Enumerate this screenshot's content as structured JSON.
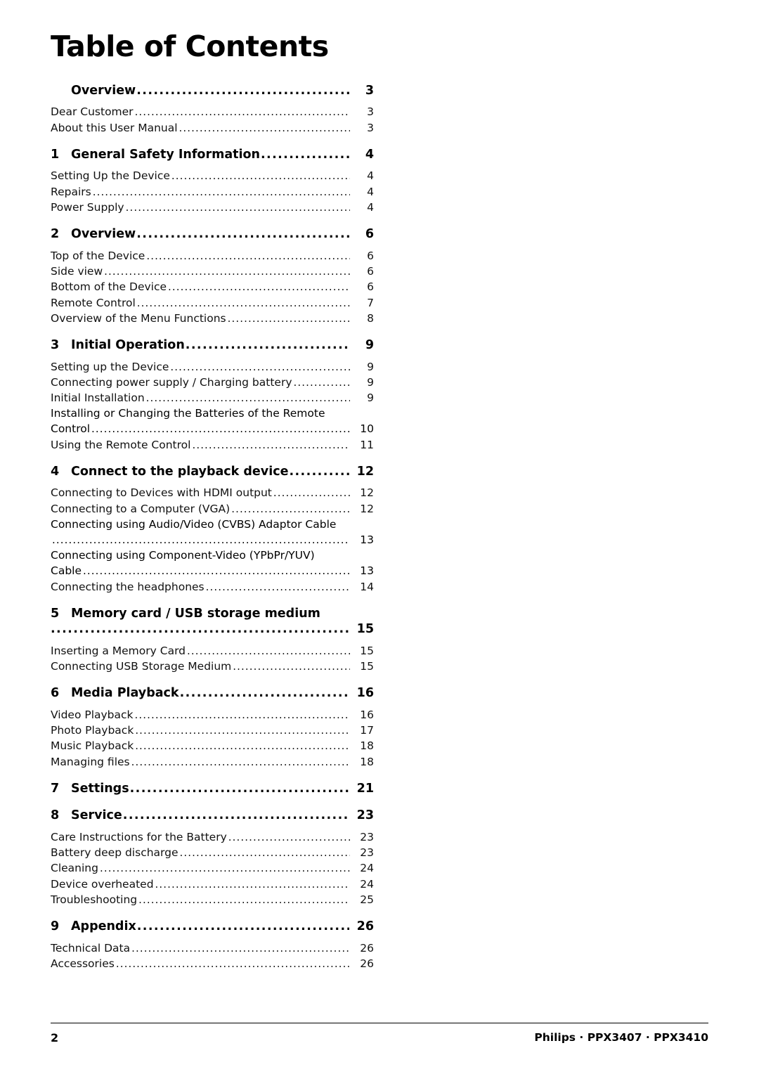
{
  "page": {
    "title": "Table of Contents",
    "page_number": "2",
    "footer_right": "Philips · PPX3407 · PPX3410"
  },
  "toc": [
    {
      "type": "chapter",
      "num": "",
      "label": "Overview",
      "page": "3"
    },
    {
      "type": "entry",
      "label": "Dear Customer",
      "page": "3"
    },
    {
      "type": "entry",
      "label": "About this User Manual",
      "page": "3"
    },
    {
      "type": "chapter",
      "num": "1",
      "label": "General Safety Information",
      "page": "4"
    },
    {
      "type": "entry",
      "label": "Setting Up the Device",
      "page": "4"
    },
    {
      "type": "entry",
      "label": "Repairs",
      "page": "4"
    },
    {
      "type": "entry",
      "label": "Power Supply ",
      "page": "4"
    },
    {
      "type": "chapter",
      "num": "2",
      "label": "Overview",
      "page": "6"
    },
    {
      "type": "entry",
      "label": "Top of the Device",
      "page": "6"
    },
    {
      "type": "entry",
      "label": "Side view",
      "page": "6"
    },
    {
      "type": "entry",
      "label": "Bottom of the Device ",
      "page": "6"
    },
    {
      "type": "entry",
      "label": "Remote Control",
      "page": "7"
    },
    {
      "type": "entry",
      "label": "Overview of the Menu Functions",
      "page": "8"
    },
    {
      "type": "chapter",
      "num": "3",
      "label": "Initial Operation",
      "page": "9"
    },
    {
      "type": "entry",
      "label": "Setting up the Device",
      "page": "9"
    },
    {
      "type": "entry",
      "label": "Connecting power supply / Charging battery ",
      "page": "9"
    },
    {
      "type": "entry",
      "label": "Initial Installation",
      "page": "9"
    },
    {
      "type": "entry_wrap",
      "line1": "Installing or Changing the Batteries of the Remote",
      "line2": "Control",
      "page": "10"
    },
    {
      "type": "entry",
      "label": "Using the Remote Control ",
      "page": "11"
    },
    {
      "type": "chapter",
      "num": "4",
      "label": "Connect to the playback device",
      "page": "12"
    },
    {
      "type": "entry",
      "label": "Connecting to Devices with HDMI output ",
      "page": "12"
    },
    {
      "type": "entry",
      "label": "Connecting to a Computer (VGA)",
      "page": "12"
    },
    {
      "type": "entry_wrap",
      "line1": "Connecting using Audio/Video (CVBS) Adaptor Cable",
      "line2": "",
      "page": "13"
    },
    {
      "type": "entry_wrap",
      "line1": "Connecting using Component-Video (YPbPr/YUV)",
      "line2": "Cable",
      "page": "13"
    },
    {
      "type": "entry",
      "label": "Connecting the headphones ",
      "page": "14"
    },
    {
      "type": "chapter_wrap",
      "num": "5",
      "label": "Memory card / USB storage medium",
      "page": "15"
    },
    {
      "type": "entry",
      "label": "Inserting a Memory Card ",
      "page": "15"
    },
    {
      "type": "entry",
      "label": "Connecting USB Storage Medium ",
      "page": "15"
    },
    {
      "type": "chapter",
      "num": "6",
      "label": "Media Playback",
      "page": "16"
    },
    {
      "type": "entry",
      "label": "Video Playback",
      "page": "16"
    },
    {
      "type": "entry",
      "label": "Photo Playback ",
      "page": "17"
    },
    {
      "type": "entry",
      "label": "Music Playback",
      "page": "18"
    },
    {
      "type": "entry",
      "label": "Managing files ",
      "page": "18"
    },
    {
      "type": "chapter",
      "num": "7",
      "label": "Settings",
      "page": "21"
    },
    {
      "type": "chapter",
      "num": "8",
      "label": "Service",
      "page": "23"
    },
    {
      "type": "entry",
      "label": "Care Instructions for the Battery ",
      "page": "23"
    },
    {
      "type": "entry",
      "label": "Battery deep discharge ",
      "page": "23"
    },
    {
      "type": "entry",
      "label": "Cleaning",
      "page": "24"
    },
    {
      "type": "entry",
      "label": "Device overheated ",
      "page": "24"
    },
    {
      "type": "entry",
      "label": "Troubleshooting ",
      "page": "25"
    },
    {
      "type": "chapter",
      "num": "9",
      "label": "Appendix",
      "page": "26"
    },
    {
      "type": "entry",
      "label": "Technical Data ",
      "page": "26"
    },
    {
      "type": "entry",
      "label": "Accessories",
      "page": "26"
    }
  ]
}
